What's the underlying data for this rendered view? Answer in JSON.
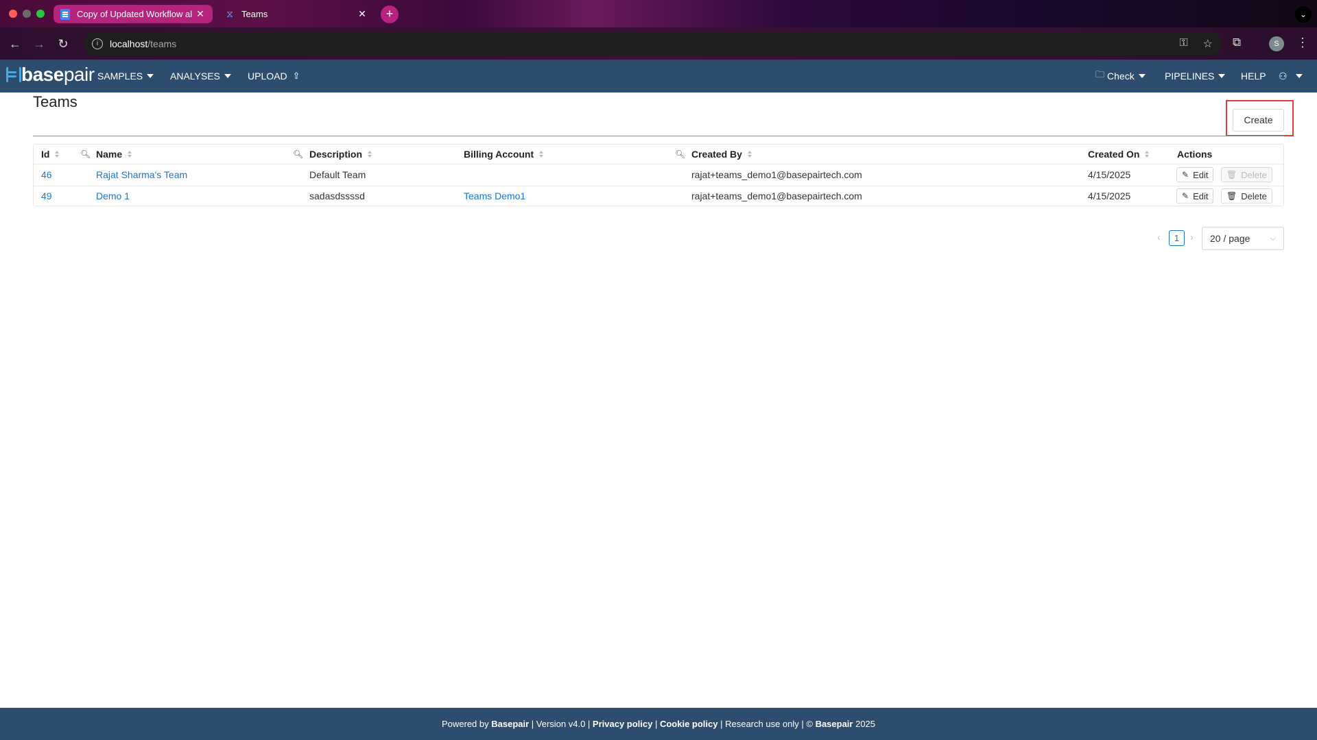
{
  "browser": {
    "tabs": [
      {
        "title": "Copy of Updated Workflow al",
        "icon": "docs-icon",
        "active": true
      },
      {
        "title": "Teams",
        "icon": "basepair-icon",
        "active": false
      }
    ],
    "url_host": "localhost",
    "url_path": "/teams",
    "profile_initial": "S"
  },
  "app": {
    "logo_bold": "base",
    "logo_light": "pair",
    "nav_left": [
      "SAMPLES",
      "ANALYSES",
      "UPLOAD"
    ],
    "nav_right": [
      "Check",
      "PIPELINES",
      "HELP"
    ]
  },
  "page": {
    "title": "Teams",
    "create_label": "Create"
  },
  "table": {
    "headers": {
      "id": "Id",
      "name": "Name",
      "description": "Description",
      "billing": "Billing Account",
      "created_by": "Created By",
      "created_on": "Created On",
      "actions": "Actions"
    },
    "rows": [
      {
        "id": "46",
        "name": "Rajat Sharma's Team",
        "description": "Default Team",
        "billing": "",
        "created_by": "rajat+teams_demo1@basepairtech.com",
        "created_on": "4/15/2025",
        "edit": "Edit",
        "delete": "Delete",
        "delete_disabled": true
      },
      {
        "id": "49",
        "name": "Demo 1",
        "description": "sadasdssssd",
        "billing": "Teams Demo1",
        "created_by": "rajat+teams_demo1@basepairtech.com",
        "created_on": "4/15/2025",
        "edit": "Edit",
        "delete": "Delete",
        "delete_disabled": false
      }
    ]
  },
  "pagination": {
    "current_page": "1",
    "page_size": "20 / page"
  },
  "footer": {
    "powered_by": "Powered by ",
    "brand": "Basepair",
    "version": " | Version v4.0 | ",
    "privacy": "Privacy policy",
    "sep": " | ",
    "cookie": "Cookie policy",
    "research": " | Research use only | © ",
    "brand2": "Basepair",
    "year": " 2025"
  },
  "colors": {
    "header_bg": "#2d4d6e",
    "link": "#1677d2",
    "highlight": "#e04030"
  }
}
